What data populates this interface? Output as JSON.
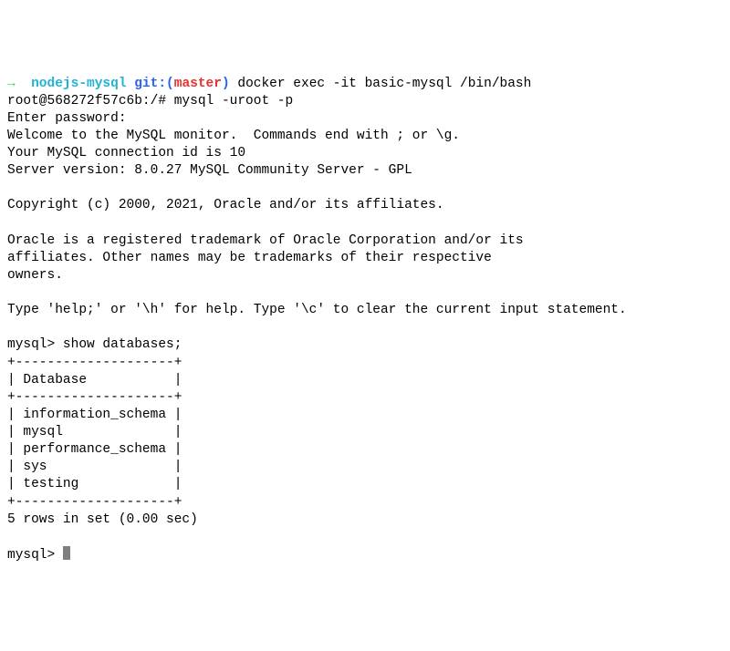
{
  "prompt": {
    "arrow": "→",
    "dir": "nodejs-mysql",
    "git_label": "git:(",
    "branch": "master",
    "git_close": ")",
    "cmd1": "docker exec -it basic-mysql /bin/bash"
  },
  "root_line": "root@568272f57c6b:/# mysql -uroot -p",
  "enter_pw": "Enter password:",
  "welcome": "Welcome to the MySQL monitor.  Commands end with ; or \\g.",
  "conn_id": "Your MySQL connection id is 10",
  "server_ver": "Server version: 8.0.27 MySQL Community Server - GPL",
  "copyright": "Copyright (c) 2000, 2021, Oracle and/or its affiliates.",
  "trademark1": "Oracle is a registered trademark of Oracle Corporation and/or its",
  "trademark2": "affiliates. Other names may be trademarks of their respective",
  "trademark3": "owners.",
  "help_line": "Type 'help;' or '\\h' for help. Type '\\c' to clear the current input statement.",
  "mysql_prompt1": "mysql> show databases;",
  "table": {
    "border": "+--------------------+",
    "header": "| Database           |",
    "rows": [
      "| information_schema |",
      "| mysql              |",
      "| performance_schema |",
      "| sys                |",
      "| testing            |"
    ]
  },
  "rows_msg": "5 rows in set (0.00 sec)",
  "mysql_prompt2": "mysql> "
}
